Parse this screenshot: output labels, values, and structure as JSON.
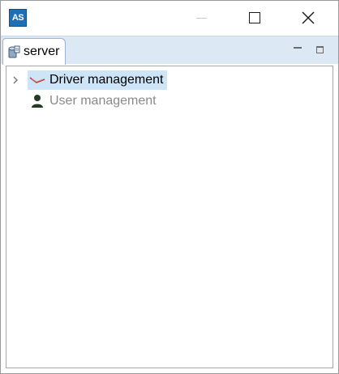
{
  "window": {
    "app_icon_text": "AS",
    "controls": [
      "minimize",
      "maximize",
      "close"
    ]
  },
  "tabbar": {
    "tab_label": "server",
    "tab_icon": "server-icon"
  },
  "tree": {
    "items": [
      {
        "label": "Driver management",
        "icon": "driver-icon",
        "selected": true,
        "expandable": true,
        "enabled": true
      },
      {
        "label": "User management",
        "icon": "user-icon",
        "selected": false,
        "expandable": false,
        "enabled": false
      }
    ]
  },
  "colors": {
    "selection": "#cde5f7",
    "tabbar_bg": "#dde8f5",
    "app_icon_bg": "#1f6fb5",
    "disabled_text": "#8a8a8a"
  }
}
